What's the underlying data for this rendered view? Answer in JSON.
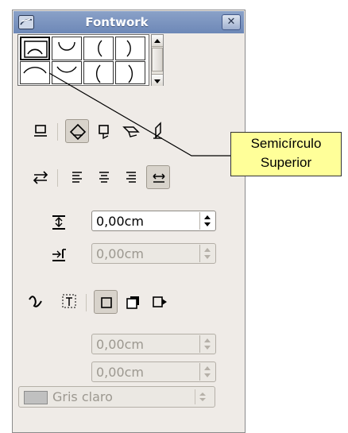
{
  "window": {
    "title": "Fontwork",
    "close_label": "✕"
  },
  "gallery": {
    "selected_index": 0,
    "shapes": [
      "arc-top-icon",
      "arc-bottom-icon",
      "arc-left-icon",
      "arc-right-icon",
      "open-circle-top-icon",
      "open-circle-bottom-icon",
      "open-circle-left-icon",
      "open-circle-right-icon"
    ]
  },
  "toolbar_orientation": {
    "items": [
      {
        "name": "off-button",
        "icon": "underline-box-icon",
        "pressed": false
      },
      {
        "name": "rotate-button",
        "icon": "rotate-diamond-icon",
        "pressed": true
      },
      {
        "name": "upright-button",
        "icon": "upright-box-icon",
        "pressed": false
      },
      {
        "name": "slant-horizontal-button",
        "icon": "slant-horizontal-icon",
        "pressed": false
      },
      {
        "name": "slant-vertical-button",
        "icon": "slant-vertical-icon",
        "pressed": false
      }
    ]
  },
  "toolbar_alignment": {
    "items": [
      {
        "name": "orientation-button",
        "icon": "swap-arrows-icon",
        "pressed": false
      },
      {
        "name": "align-left-button",
        "icon": "align-left-icon",
        "pressed": false
      },
      {
        "name": "align-center-button",
        "icon": "align-center-icon",
        "pressed": false
      },
      {
        "name": "align-right-button",
        "icon": "align-right-icon",
        "pressed": false
      },
      {
        "name": "autosize-button",
        "icon": "stretch-arrows-icon",
        "pressed": true
      }
    ]
  },
  "distance": {
    "value": "0,00cm",
    "enabled": true
  },
  "indent": {
    "value": "0,00cm",
    "enabled": false
  },
  "toolbar_shadow": {
    "items": [
      {
        "name": "contour-button",
        "icon": "contour-curve-icon",
        "pressed": false
      },
      {
        "name": "text-contour-button",
        "icon": "text-frame-icon",
        "pressed": false
      },
      {
        "name": "no-shadow-button",
        "icon": "square-icon",
        "pressed": true
      },
      {
        "name": "vertical-shadow-button",
        "icon": "square-shadow-icon",
        "pressed": false
      },
      {
        "name": "slant-shadow-button",
        "icon": "slant-shadow-icon",
        "pressed": false
      }
    ]
  },
  "shadow_x": {
    "value": "0,00cm",
    "enabled": false
  },
  "shadow_y": {
    "value": "0,00cm",
    "enabled": false
  },
  "shadow_color": {
    "label": "Gris claro",
    "swatch": "#c0c0c0",
    "enabled": false
  },
  "tooltip": {
    "line1": "Semicírculo",
    "line2": "Superior"
  },
  "colors": {
    "titlebar": "#7892c0",
    "window_bg": "#efebe7",
    "tooltip_bg": "#ffff99",
    "icon": "#000000",
    "disabled_text": "#9c9890"
  }
}
